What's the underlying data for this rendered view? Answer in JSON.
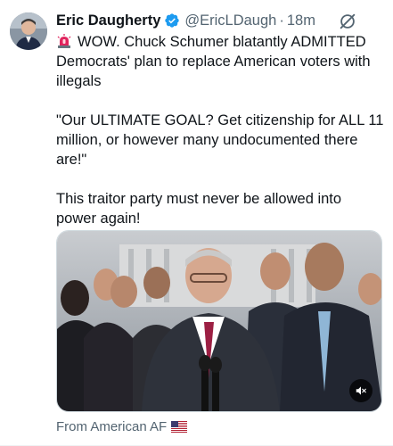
{
  "author": {
    "name": "Eric Daugherty",
    "handle": "@EricLDaugh",
    "separator": "·",
    "time": "18m",
    "verified": true
  },
  "icons": {
    "verified": "verified-badge-icon",
    "grok": "grok-icon",
    "siren": "siren-emoji-icon",
    "mute": "volume-muted-icon",
    "flag": "us-flag-emoji-icon"
  },
  "tweet": {
    "line1": "WOW. Chuck Schumer blatantly ADMITTED Democrats' plan to replace American voters with illegals",
    "quote": "\"Our ULTIMATE GOAL? Get citizenship for ALL 11 million, or however many undocumented there are!\"",
    "closing": "This traitor party must never be allowed into power again!"
  },
  "source": {
    "label": "From American AF"
  },
  "colors": {
    "text": "#0f1419",
    "secondary": "#536471",
    "verified": "#1d9bf0",
    "border": "#cfd9de"
  }
}
